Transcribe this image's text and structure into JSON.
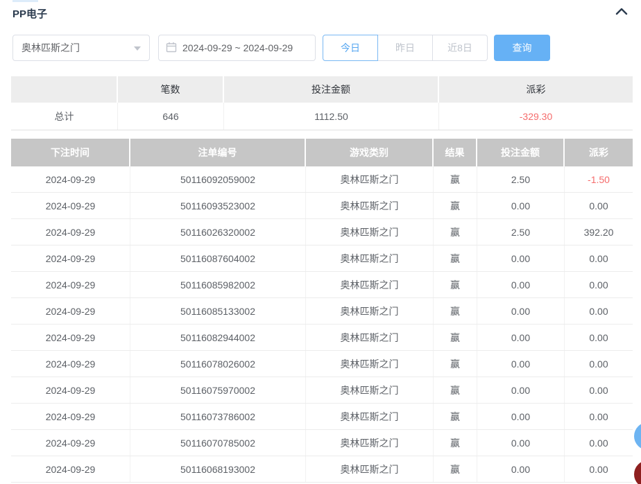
{
  "panel": {
    "title": "PP电子"
  },
  "filters": {
    "game_select": {
      "value": "奥林匹斯之门"
    },
    "date_range": {
      "value": "2024-09-29 ~ 2024-09-29"
    },
    "quick_buttons": [
      {
        "label": "今日",
        "active": true
      },
      {
        "label": "昨日",
        "active": false
      },
      {
        "label": "近8日",
        "active": false
      }
    ],
    "search_label": "查询"
  },
  "summary": {
    "headers": [
      "",
      "笔数",
      "投注金额",
      "派彩"
    ],
    "row": {
      "label": "总计",
      "count": "646",
      "bet": "1112.50",
      "payout": "-329.30"
    }
  },
  "table": {
    "headers": [
      "下注时间",
      "注单编号",
      "游戏类别",
      "结果",
      "投注金额",
      "派彩"
    ],
    "rows": [
      {
        "date": "2024-09-29",
        "order": "50116092059002",
        "game": "奥林匹斯之门",
        "result": "赢",
        "bet": "2.50",
        "payout": "-1.50"
      },
      {
        "date": "2024-09-29",
        "order": "50116093523002",
        "game": "奥林匹斯之门",
        "result": "赢",
        "bet": "0.00",
        "payout": "0.00"
      },
      {
        "date": "2024-09-29",
        "order": "50116026320002",
        "game": "奥林匹斯之门",
        "result": "赢",
        "bet": "2.50",
        "payout": "392.20"
      },
      {
        "date": "2024-09-29",
        "order": "50116087604002",
        "game": "奥林匹斯之门",
        "result": "赢",
        "bet": "0.00",
        "payout": "0.00"
      },
      {
        "date": "2024-09-29",
        "order": "50116085982002",
        "game": "奥林匹斯之门",
        "result": "赢",
        "bet": "0.00",
        "payout": "0.00"
      },
      {
        "date": "2024-09-29",
        "order": "50116085133002",
        "game": "奥林匹斯之门",
        "result": "赢",
        "bet": "0.00",
        "payout": "0.00"
      },
      {
        "date": "2024-09-29",
        "order": "50116082944002",
        "game": "奥林匹斯之门",
        "result": "赢",
        "bet": "0.00",
        "payout": "0.00"
      },
      {
        "date": "2024-09-29",
        "order": "50116078026002",
        "game": "奥林匹斯之门",
        "result": "赢",
        "bet": "0.00",
        "payout": "0.00"
      },
      {
        "date": "2024-09-29",
        "order": "50116075970002",
        "game": "奥林匹斯之门",
        "result": "赢",
        "bet": "0.00",
        "payout": "0.00"
      },
      {
        "date": "2024-09-29",
        "order": "50116073786002",
        "game": "奥林匹斯之门",
        "result": "赢",
        "bet": "0.00",
        "payout": "0.00"
      },
      {
        "date": "2024-09-29",
        "order": "50116070785002",
        "game": "奥林匹斯之门",
        "result": "赢",
        "bet": "0.00",
        "payout": "0.00"
      },
      {
        "date": "2024-09-29",
        "order": "50116068193002",
        "game": "奥林匹斯之门",
        "result": "赢",
        "bet": "0.00",
        "payout": "0.00"
      }
    ]
  },
  "colors": {
    "accent_blue": "#66b1f5",
    "danger_red": "#f56c6c",
    "table_header_bg": "#c6c6c6",
    "title_navy": "#2b3b4e"
  }
}
